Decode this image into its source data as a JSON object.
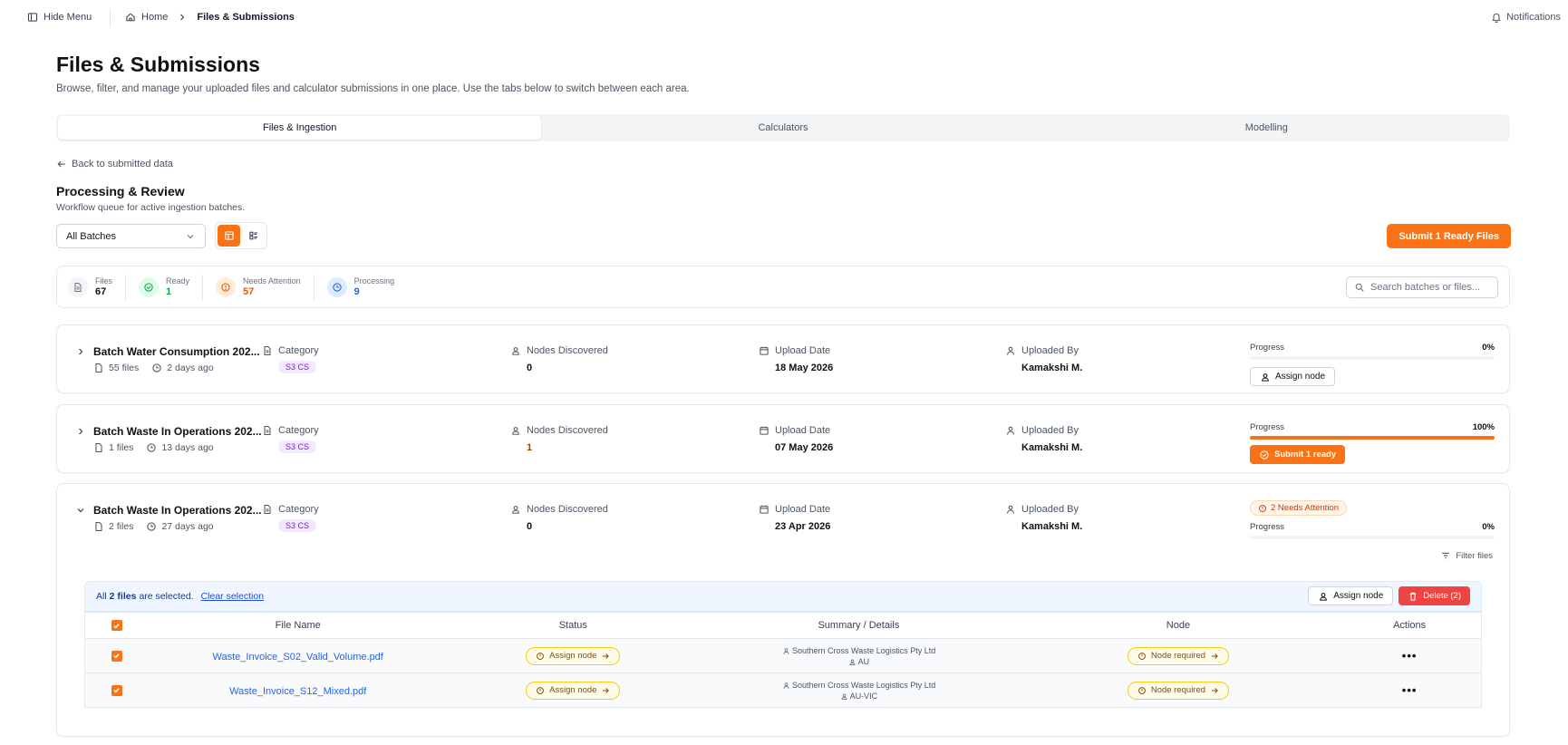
{
  "topbar": {
    "hide_menu": "Hide Menu",
    "home": "Home",
    "current": "Files & Submissions",
    "notifications": "Notifications"
  },
  "page": {
    "title": "Files & Submissions",
    "subtitle": "Browse, filter, and manage your uploaded files and calculator submissions in one place. Use the tabs below to switch between each area."
  },
  "tabs": [
    {
      "label": "Files & Ingestion",
      "active": true
    },
    {
      "label": "Calculators",
      "active": false
    },
    {
      "label": "Modelling",
      "active": false
    }
  ],
  "back_label": "Back to submitted data",
  "section": {
    "title": "Processing & Review",
    "subtitle": "Workflow queue for active ingestion batches."
  },
  "filter_select": "All Batches",
  "submit_ready_label": "Submit 1 Ready Files",
  "stats": [
    {
      "label": "Files",
      "value": "67",
      "color": "#6b7280",
      "bg": "#f3f4f6",
      "icon": "file-icon"
    },
    {
      "label": "Ready",
      "value": "1",
      "color": "#16a34a",
      "bg": "#dcfce7",
      "icon": "check-circle-icon"
    },
    {
      "label": "Needs Attention",
      "value": "57",
      "color": "#ea580c",
      "bg": "#ffedd5",
      "icon": "alert-circle-icon"
    },
    {
      "label": "Processing",
      "value": "9",
      "color": "#2563eb",
      "bg": "#dbeafe",
      "icon": "clock-icon"
    }
  ],
  "search_placeholder": "Search batches or files...",
  "columns": {
    "category": "Category",
    "nodes": "Nodes Discovered",
    "upload": "Upload Date",
    "uploaded_by": "Uploaded By",
    "progress": "Progress"
  },
  "batches": [
    {
      "name": "Batch Water Consumption 202...",
      "files": "55 files",
      "ago": "2 days ago",
      "category": "S3 CS",
      "nodes": "0",
      "date": "18 May 2026",
      "by": "Kamakshi M.",
      "progress": 0,
      "progress_label": "0%",
      "action": "Assign node"
    },
    {
      "name": "Batch Waste In Operations 202...",
      "files": "1 files",
      "ago": "13 days ago",
      "category": "S3 CS",
      "nodes": "1",
      "date": "07 May 2026",
      "by": "Kamakshi M.",
      "progress": 1,
      "progress_label": "100%",
      "action": "Submit 1 ready"
    },
    {
      "name": "Batch Waste In Operations 202...",
      "files": "2 files",
      "ago": "27 days ago",
      "category": "S3 CS",
      "nodes": "0",
      "date": "23 Apr 2026",
      "by": "Kamakshi M.",
      "progress": 0,
      "progress_label": "0%",
      "attention": "2 Needs Attention",
      "filter_files": "Filter files"
    }
  ],
  "selection": {
    "prefix": "All",
    "count": "2 files",
    "suffix": "are selected.",
    "clear": "Clear selection",
    "assign": "Assign node",
    "delete": "Delete (2)"
  },
  "table": {
    "headers": [
      "File Name",
      "Status",
      "Summary / Details",
      "Node",
      "Actions"
    ],
    "rows": [
      {
        "file": "Waste_Invoice_S02_Valid_Volume.pdf",
        "status": "Assign node",
        "company": "Southern Cross Waste Logistics Pty Ltd",
        "region": "AU",
        "node": "Node required",
        "actions": "•••"
      },
      {
        "file": "Waste_Invoice_S12_Mixed.pdf",
        "status": "Assign node",
        "company": "Southern Cross Waste Logistics Pty Ltd",
        "region": "AU-VIC",
        "node": "Node required",
        "actions": "•••"
      }
    ]
  },
  "accent": "#f97316"
}
